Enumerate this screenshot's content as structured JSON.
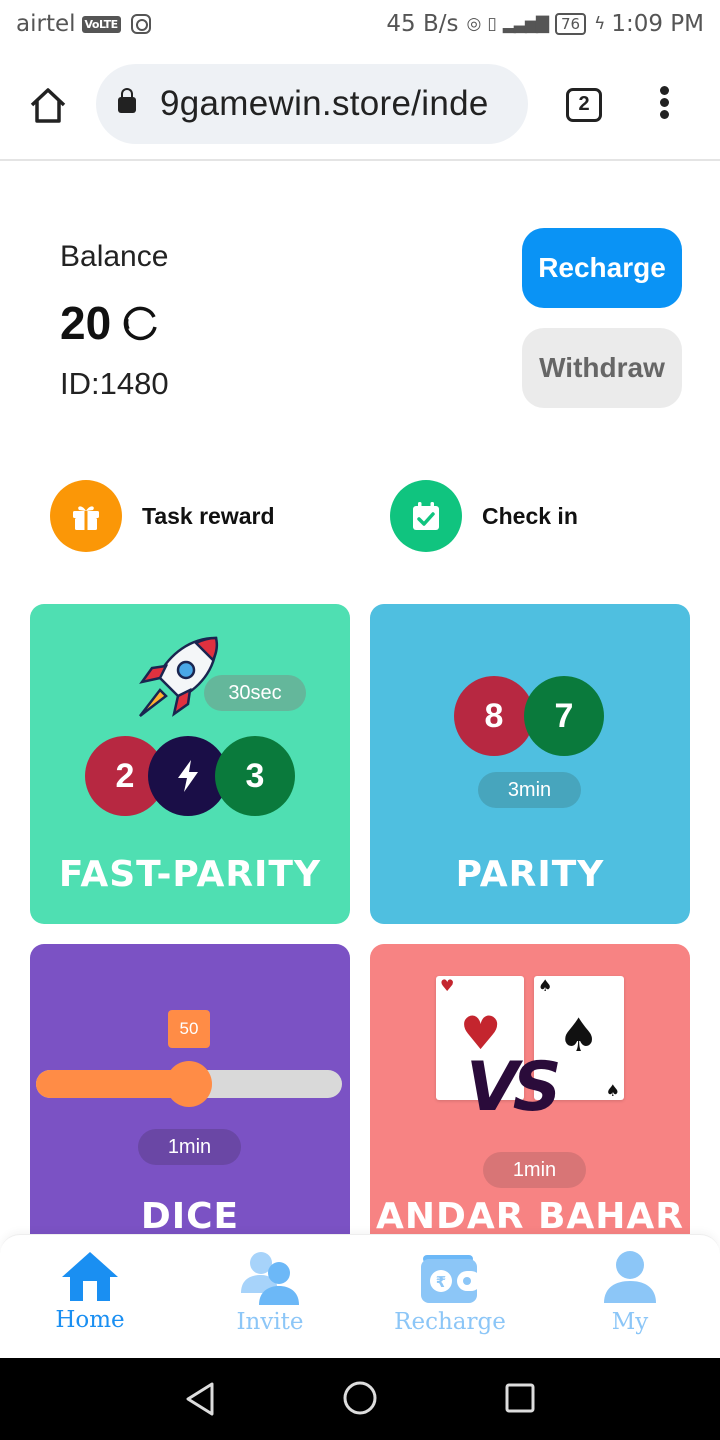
{
  "status_bar": {
    "carrier": "airtel",
    "volte": "VoLTE",
    "speed": "45 B/s",
    "battery": "76",
    "time": "1:09 PM"
  },
  "browser": {
    "url": "9gamewin.store/inde",
    "tab_count": "2"
  },
  "account": {
    "balance_label": "Balance",
    "balance": "20",
    "id": "ID:1480",
    "recharge_label": "Recharge",
    "withdraw_label": "Withdraw"
  },
  "quick_actions": {
    "task_reward": "Task reward",
    "check_in": "Check in"
  },
  "games": {
    "fast_parity": {
      "title": "FAST-PARITY",
      "duration": "30sec",
      "balls": [
        "2",
        "3"
      ]
    },
    "parity": {
      "title": "PARITY",
      "duration": "3min",
      "balls": [
        "8",
        "7"
      ]
    },
    "dice": {
      "title": "DICE",
      "duration": "1min",
      "slider_value": "50",
      "slider_fraction": 0.5
    },
    "andar_bahar": {
      "title": "ANDAR BAHAR",
      "duration": "1min",
      "vs": "VS"
    }
  },
  "bottom_nav": {
    "home": "Home",
    "invite": "Invite",
    "recharge": "Recharge",
    "my": "My"
  },
  "colors": {
    "primary_blue": "#0a93f5",
    "fast_parity_bg": "#4fdfb2",
    "parity_bg": "#4fbfe0",
    "dice_bg": "#7b52c4",
    "andar_bahar_bg": "#f78383",
    "ball_red": "#b72841",
    "ball_green": "#0a7a3c",
    "ball_navy": "#1a0e47"
  }
}
